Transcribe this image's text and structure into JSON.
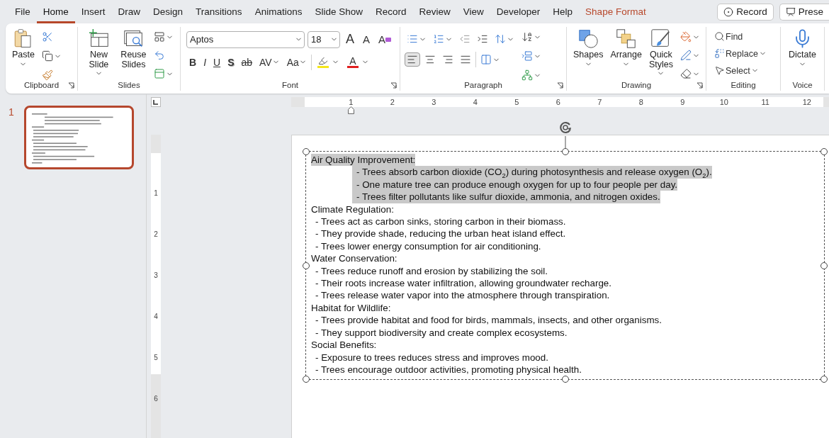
{
  "tabs": [
    {
      "label": "File",
      "selected": false,
      "kind": "tab"
    },
    {
      "label": "Home",
      "selected": true,
      "kind": "tab"
    },
    {
      "label": "Insert",
      "selected": false,
      "kind": "tab"
    },
    {
      "label": "Draw",
      "selected": false,
      "kind": "tab"
    },
    {
      "label": "Design",
      "selected": false,
      "kind": "tab"
    },
    {
      "label": "Transitions",
      "selected": false,
      "kind": "tab"
    },
    {
      "label": "Animations",
      "selected": false,
      "kind": "tab"
    },
    {
      "label": "Slide Show",
      "selected": false,
      "kind": "tab"
    },
    {
      "label": "Record",
      "selected": false,
      "kind": "tab"
    },
    {
      "label": "Review",
      "selected": false,
      "kind": "tab"
    },
    {
      "label": "View",
      "selected": false,
      "kind": "tab"
    },
    {
      "label": "Developer",
      "selected": false,
      "kind": "tab"
    },
    {
      "label": "Help",
      "selected": false,
      "kind": "tab"
    },
    {
      "label": "Shape Format",
      "selected": false,
      "kind": "contextual"
    }
  ],
  "header_buttons": [
    {
      "label": "Record",
      "kind": "record"
    },
    {
      "label": "Prese",
      "kind": "present"
    }
  ],
  "ribbon": {
    "clipboard": {
      "label": "Clipboard",
      "paste": "Paste"
    },
    "slides": {
      "label": "Slides",
      "new_slide": "New Slide",
      "reuse_slides": "Reuse Slides"
    },
    "font": {
      "label": "Font",
      "font_name": "Aptos",
      "font_size": "18",
      "size_buttons": [
        {
          "kind": "grow",
          "label": "A"
        },
        {
          "kind": "shrink",
          "label": "A"
        },
        {
          "kind": "clear",
          "label": "A"
        }
      ],
      "format_buttons": [
        {
          "kind": "bold",
          "label": "B"
        },
        {
          "kind": "italic",
          "label": "I"
        },
        {
          "kind": "underline",
          "label": "U"
        },
        {
          "kind": "shadow",
          "label": "S"
        },
        {
          "kind": "strike",
          "label": "ab"
        },
        {
          "kind": "spacing",
          "label": "AV"
        },
        {
          "kind": "case",
          "label": "Aa"
        }
      ],
      "color_buttons": [
        {
          "kind": "highlight"
        },
        {
          "kind": "font_color",
          "label": "A"
        }
      ]
    },
    "paragraph": {
      "label": "Paragraph",
      "alignment": [
        {
          "kind": "left",
          "selected": true
        },
        {
          "kind": "center",
          "selected": false
        },
        {
          "kind": "right",
          "selected": false
        },
        {
          "kind": "justify",
          "selected": false
        }
      ]
    },
    "drawing": {
      "label": "Drawing",
      "shapes": "Shapes",
      "arrange": "Arrange",
      "quick_styles": "Quick Styles"
    },
    "editing": {
      "label": "Editing",
      "find": "Find",
      "replace": "Replace",
      "select": "Select"
    },
    "voice": {
      "label": "Voice",
      "dictate": "Dictate"
    }
  },
  "slides_panel": [
    {
      "number": "1",
      "selected": true
    }
  ],
  "rulers": {
    "horizontal": [
      "1",
      "2",
      "3",
      "4",
      "5",
      "6",
      "7",
      "8",
      "9",
      "10",
      "11",
      "12"
    ],
    "vertical": [
      "1",
      "2",
      "3",
      "4",
      "5",
      "6"
    ]
  },
  "text_box": {
    "sections": [
      {
        "heading": "Air Quality Improvement:",
        "highlighted": true,
        "kind": "tabbed",
        "items": [
          "- Trees absorb carbon dioxide (CO$_{2}$) during photosynthesis and release oxygen (O$_{2}$).",
          "- One mature tree can produce enough oxygen for up to four people per day.",
          "- Trees filter pollutants like sulfur dioxide, ammonia, and nitrogen oxides."
        ]
      },
      {
        "heading": "Climate Regulation:",
        "highlighted": false,
        "kind": "plain",
        "items": [
          "- Trees act as carbon sinks, storing carbon in their biomass.",
          "- They provide shade, reducing the urban heat island effect.",
          "- Trees lower energy consumption for air conditioning."
        ]
      },
      {
        "heading": "Water Conservation:",
        "highlighted": false,
        "kind": "plain",
        "items": [
          "- Trees reduce runoff and erosion by stabilizing the soil.",
          "- Their roots increase water infiltration, allowing groundwater recharge.",
          "- Trees release water vapor into the atmosphere through transpiration."
        ]
      },
      {
        "heading": "Habitat for Wildlife:",
        "highlighted": false,
        "kind": "plain",
        "items": [
          "- Trees provide habitat and food for birds, mammals, insects, and other organisms.",
          "- They support biodiversity and create complex ecosystems."
        ]
      },
      {
        "heading": "Social Benefits:",
        "highlighted": false,
        "kind": "plain",
        "items": [
          "- Exposure to trees reduces stress and improves mood.",
          "- Trees encourage outdoor activities, promoting physical health."
        ]
      }
    ]
  }
}
